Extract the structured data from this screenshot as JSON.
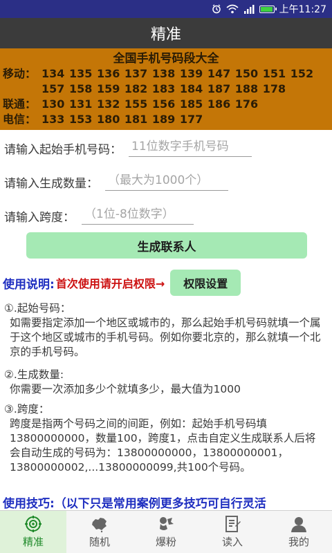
{
  "status_bar": {
    "time": "上午11:27",
    "icons": [
      "alarm-icon",
      "wifi-icon",
      "signal-icon",
      "battery-icon"
    ],
    "battery_color": "#3fd23f"
  },
  "title": "精准",
  "banner": {
    "title": "全国手机号码段大全",
    "rows": [
      {
        "label": "移动：",
        "numbers": "134 135 136 137 138 139 147 150 151 152 157 158 159 182 183 184 187 188 178"
      },
      {
        "label": "联通：",
        "numbers": "130 131 132 155 156 185 186 176"
      },
      {
        "label": "电信：",
        "numbers": "133 153 180 181 189 177"
      }
    ],
    "color": "#c47607"
  },
  "form": {
    "start_label": "请输入起始手机号码：",
    "start_placeholder": "11位数字手机号码",
    "count_label": "请输入生成数量：",
    "count_placeholder": "（最大为1000个）",
    "span_label": "请输入跨度：",
    "span_placeholder": "（1位-8位数字）",
    "generate_button": "生成联系人"
  },
  "usage": {
    "title": "使用说明:",
    "warning": "首次使用请开启权限→",
    "permission_button": "权限设置",
    "sections": [
      {
        "head": "①.起始号码：",
        "body": "如需要指定添加一个地区或城市的，那么起始手机号码就填一个属于这个地区或城市的手机号码。例如你要北京的，那么就填一个北京的手机号码。"
      },
      {
        "head": "②.生成数量:",
        "body": "你需要一次添加多少个就填多少，最大值为1000"
      },
      {
        "head": "③.跨度：",
        "body": "跨度是指两个号码之间的间距，例如：起始手机号码填13800000000，数量100，跨度1，点击自定义生成联系人后将会自动生成的号码为：13800000000，13800000001，13800000002,...13800000099,共100个号码。"
      }
    ]
  },
  "tips": "使用技巧:（以下只是常用案例更多技巧可自行灵活",
  "bottom_nav": [
    {
      "label": "精准",
      "icon": "target-icon",
      "active": true
    },
    {
      "label": "随机",
      "icon": "china-map-icon",
      "active": false
    },
    {
      "label": "爆粉",
      "icon": "fan-icon",
      "active": false
    },
    {
      "label": "读入",
      "icon": "import-icon",
      "active": false
    },
    {
      "label": "我的",
      "icon": "user-icon",
      "active": false
    }
  ],
  "colors": {
    "status_bar": "#2b2f86",
    "title_bar": "#3b3b3b",
    "button": "#a5e9b4",
    "usage_title": "#1e2ec0",
    "warning": "#cc1010",
    "nav_active": "#1f8a2a"
  }
}
